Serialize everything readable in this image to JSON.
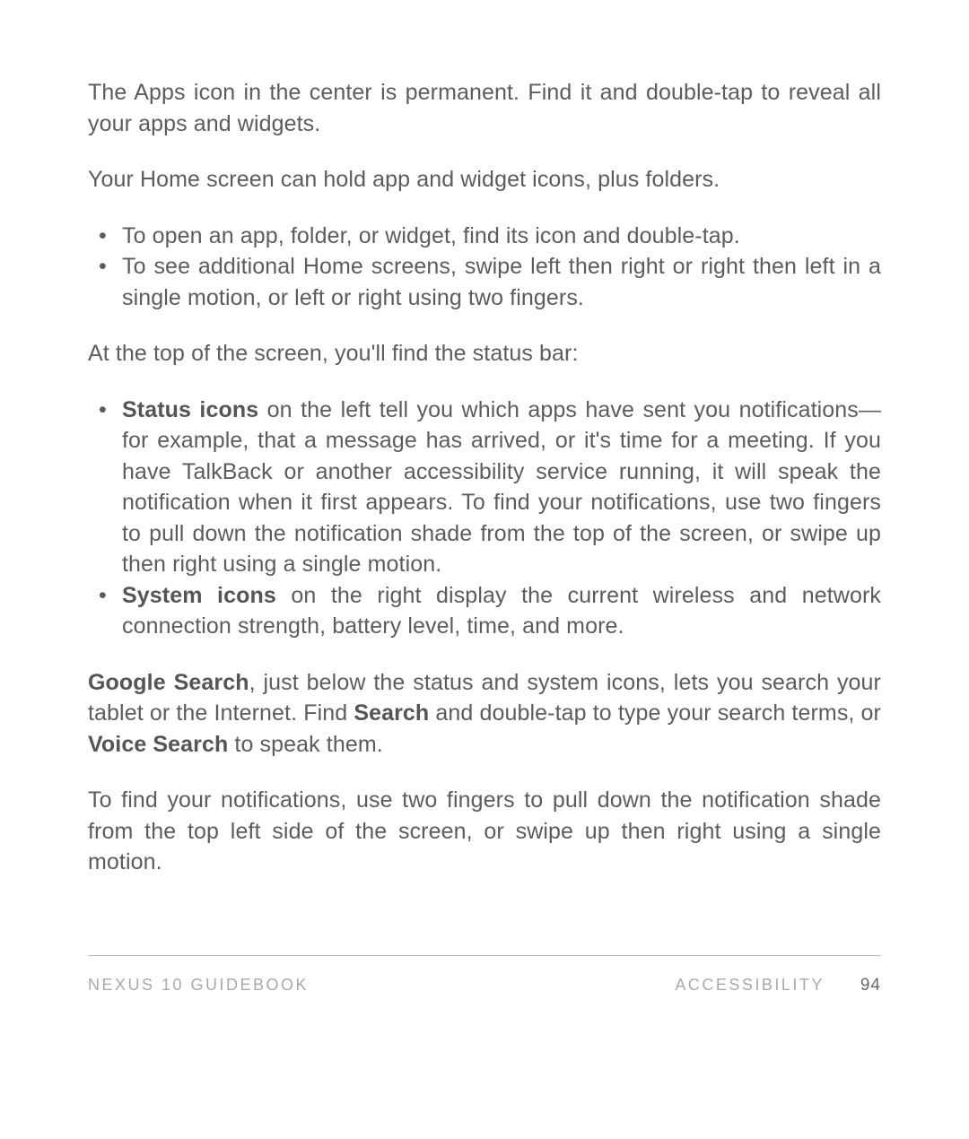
{
  "paragraphs": {
    "p1": "The Apps icon in the center is permanent. Find it and double-tap to reveal all your apps and widgets.",
    "p2": "Your Home screen can hold app and widget icons, plus folders.",
    "p3": "At the top of the screen, you'll find the status bar:",
    "p4_prefix": "Google Search",
    "p4_mid1": ", just below the status and system icons, lets you search your tablet or the Internet. Find ",
    "p4_bold2": "Search",
    "p4_mid2": " and double-tap to type your search terms, or ",
    "p4_bold3": "Voice Search",
    "p4_suffix": " to speak them.",
    "p5": "To find your notifications, use two fingers to pull down the notifi­cation shade from the top left side of the screen, or swipe up then right using a single motion."
  },
  "list1": {
    "i1": "To open an app, folder, or widget, find its icon and double-tap.",
    "i2": "To see additional Home screens, swipe left then right or right then left in a single motion, or left or right using two fingers."
  },
  "list2": {
    "i1_bold": "Status icons",
    "i1_rest": " on the left tell you which apps have sent you noti­fications—for example, that a message has arrived, or it's time for a meeting. If you have TalkBack or another accessibility ser­vice running, it will speak the notification when it first appears. To find your notifications, use two fingers to pull down the noti­fication shade from the top of the screen, or swipe up then right using a single motion.",
    "i2_bold": "System icons",
    "i2_rest": " on the right display the current wireless and net­work connection strength, battery level, time, and more."
  },
  "footer": {
    "book": "Nexus 10 Guidebook",
    "section": "Accessibility",
    "page": "94"
  }
}
